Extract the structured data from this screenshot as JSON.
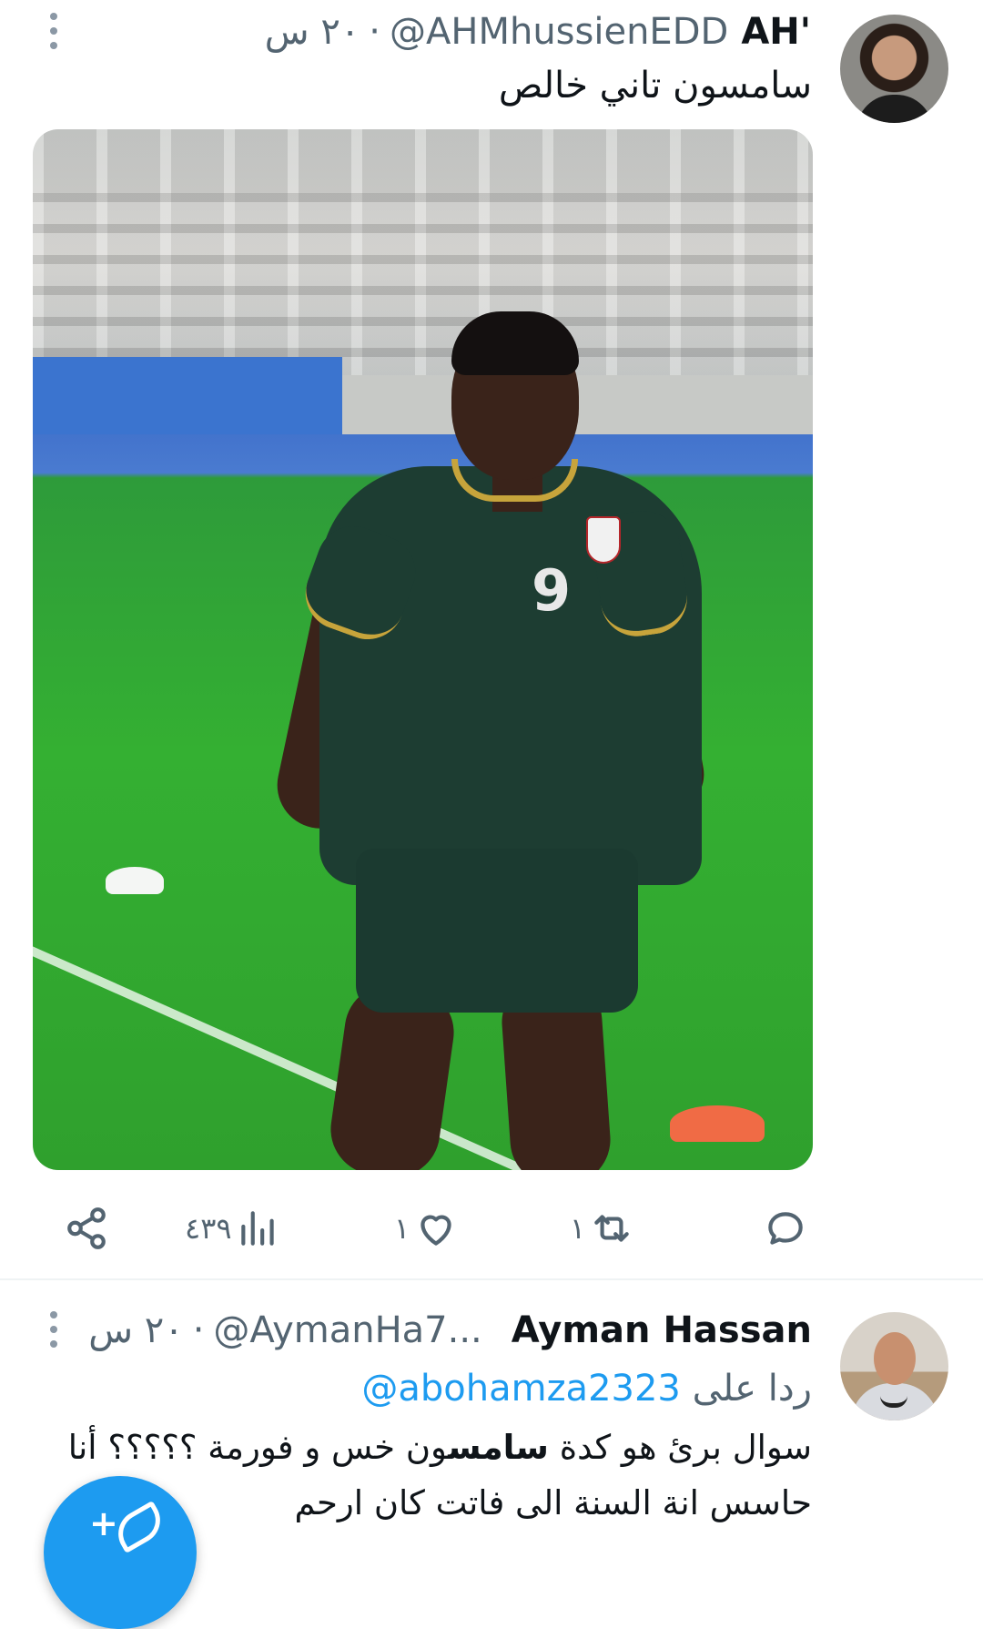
{
  "tweet1": {
    "display_name": "AH'",
    "handle": "@AHMhussienEDD",
    "separator": "·",
    "time": "٢٠ س",
    "text": "سامسون تاني خالص",
    "actions": {
      "reply_count": "",
      "retweet_count": "١",
      "like_count": "١",
      "views_count": "٤٣٩"
    }
  },
  "tweet2": {
    "display_name": "Ayman Hassan",
    "handle": "@AymanHa7...",
    "separator": "·",
    "time": "٢٠ س",
    "replying_prefix": "ردا على",
    "replying_to": "@abohamza2323",
    "text_line1_before": "سوال برئ هو كدة ",
    "text_line1_bold": "سامس",
    "text_line1_after": "ون خس و فورمة ؟؟؟؟؟ أنا",
    "text_line2": "حاسس انة السنة الى فاتت كان ارحم"
  },
  "colors": {
    "accent": "#1d9bf0",
    "muted": "#536471",
    "text": "#0f1419"
  }
}
